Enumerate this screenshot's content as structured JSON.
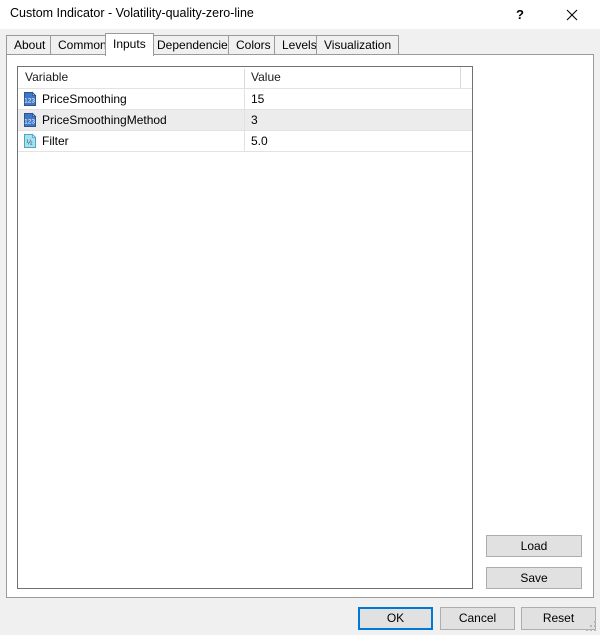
{
  "window": {
    "title": "Custom Indicator - Volatility-quality-zero-line",
    "help_label": "?",
    "close_label": "✕",
    "close_icon": "close-icon",
    "help_icon": "help-icon"
  },
  "tabs": [
    {
      "label": "About",
      "active": false
    },
    {
      "label": "Common",
      "active": false
    },
    {
      "label": "Inputs",
      "active": true
    },
    {
      "label": "Dependencies",
      "active": false
    },
    {
      "label": "Colors",
      "active": false
    },
    {
      "label": "Levels",
      "active": false
    },
    {
      "label": "Visualization",
      "active": false
    }
  ],
  "grid": {
    "columns": [
      "Variable",
      "Value"
    ],
    "rows": [
      {
        "icon": "integer-variable-icon",
        "icon_glyph": "123",
        "name": "PriceSmoothing",
        "value": "15"
      },
      {
        "icon": "integer-variable-icon",
        "icon_glyph": "123",
        "name": "PriceSmoothingMethod",
        "value": "3"
      },
      {
        "icon": "double-variable-icon",
        "icon_glyph": "½",
        "name": "Filter",
        "value": "5.0"
      }
    ]
  },
  "side_buttons": {
    "load_label": "Load",
    "save_label": "Save"
  },
  "bottom_buttons": {
    "ok_label": "OK",
    "cancel_label": "Cancel",
    "reset_label": "Reset"
  },
  "colors": {
    "accent": "#0078d7",
    "dialog_bg": "#f0f0f0",
    "panel_bg": "#ffffff",
    "button_bg": "#e1e1e1",
    "button_border": "#adadad",
    "grid_border": "#6e7277",
    "row_alt_bg": "#ececec"
  }
}
